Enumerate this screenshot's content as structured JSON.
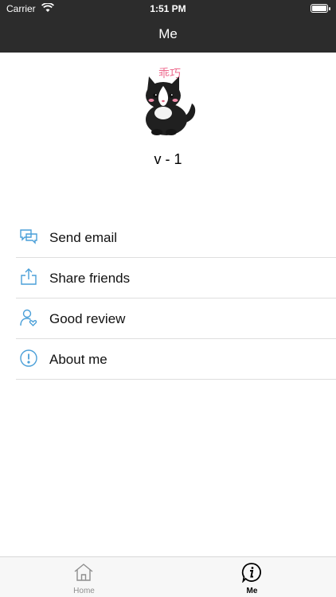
{
  "status_bar": {
    "carrier": "Carrier",
    "time": "1:51 PM"
  },
  "nav": {
    "title": "Me"
  },
  "profile": {
    "version": "v - 1",
    "avatar_caption": "乖巧"
  },
  "menu": {
    "items": [
      {
        "label": "Send email",
        "icon": "chat-bubbles-icon"
      },
      {
        "label": "Share friends",
        "icon": "share-upload-icon"
      },
      {
        "label": "Good review",
        "icon": "user-heart-icon"
      },
      {
        "label": "About me",
        "icon": "exclamation-circle-icon"
      }
    ]
  },
  "tabbar": {
    "tabs": [
      {
        "label": "Home",
        "icon": "house-icon",
        "selected": false
      },
      {
        "label": "Me",
        "icon": "info-chat-icon",
        "selected": true
      }
    ]
  },
  "colors": {
    "accent": "#4a9fd8",
    "header_bg": "#2c2c2c"
  }
}
